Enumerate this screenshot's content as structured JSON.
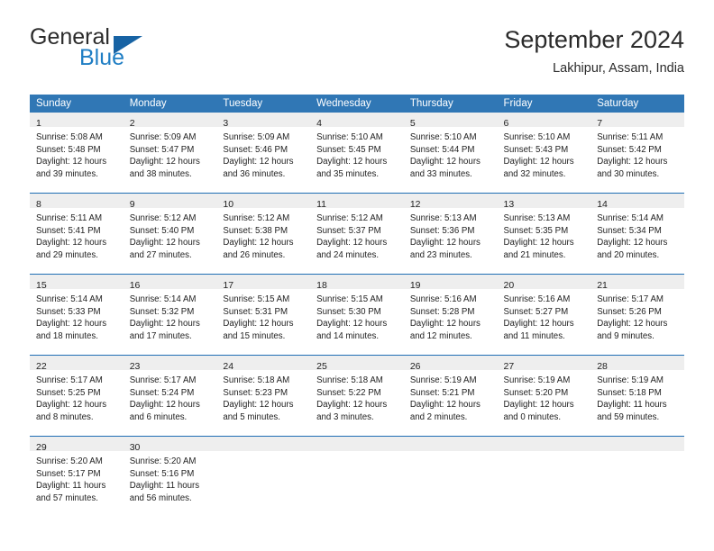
{
  "brand": {
    "word_one": "General",
    "word_two": "Blue",
    "triangle_icon": "triangle-icon",
    "accent_color": "#1763a4",
    "blue_text_color": "#1f7ec4"
  },
  "header": {
    "title": "September 2024",
    "subtitle": "Lakhipur, Assam, India"
  },
  "theme": {
    "header_band": "#3077b5",
    "week_separator": "#1f6eb4",
    "daynum_band": "#eeeeee"
  },
  "weekday_headers": [
    "Sunday",
    "Monday",
    "Tuesday",
    "Wednesday",
    "Thursday",
    "Friday",
    "Saturday"
  ],
  "weeks": [
    [
      {
        "day": "1",
        "sunrise": "Sunrise: 5:08 AM",
        "sunset": "Sunset: 5:48 PM",
        "daylight_line1": "Daylight: 12 hours",
        "daylight_line2": "and 39 minutes."
      },
      {
        "day": "2",
        "sunrise": "Sunrise: 5:09 AM",
        "sunset": "Sunset: 5:47 PM",
        "daylight_line1": "Daylight: 12 hours",
        "daylight_line2": "and 38 minutes."
      },
      {
        "day": "3",
        "sunrise": "Sunrise: 5:09 AM",
        "sunset": "Sunset: 5:46 PM",
        "daylight_line1": "Daylight: 12 hours",
        "daylight_line2": "and 36 minutes."
      },
      {
        "day": "4",
        "sunrise": "Sunrise: 5:10 AM",
        "sunset": "Sunset: 5:45 PM",
        "daylight_line1": "Daylight: 12 hours",
        "daylight_line2": "and 35 minutes."
      },
      {
        "day": "5",
        "sunrise": "Sunrise: 5:10 AM",
        "sunset": "Sunset: 5:44 PM",
        "daylight_line1": "Daylight: 12 hours",
        "daylight_line2": "and 33 minutes."
      },
      {
        "day": "6",
        "sunrise": "Sunrise: 5:10 AM",
        "sunset": "Sunset: 5:43 PM",
        "daylight_line1": "Daylight: 12 hours",
        "daylight_line2": "and 32 minutes."
      },
      {
        "day": "7",
        "sunrise": "Sunrise: 5:11 AM",
        "sunset": "Sunset: 5:42 PM",
        "daylight_line1": "Daylight: 12 hours",
        "daylight_line2": "and 30 minutes."
      }
    ],
    [
      {
        "day": "8",
        "sunrise": "Sunrise: 5:11 AM",
        "sunset": "Sunset: 5:41 PM",
        "daylight_line1": "Daylight: 12 hours",
        "daylight_line2": "and 29 minutes."
      },
      {
        "day": "9",
        "sunrise": "Sunrise: 5:12 AM",
        "sunset": "Sunset: 5:40 PM",
        "daylight_line1": "Daylight: 12 hours",
        "daylight_line2": "and 27 minutes."
      },
      {
        "day": "10",
        "sunrise": "Sunrise: 5:12 AM",
        "sunset": "Sunset: 5:38 PM",
        "daylight_line1": "Daylight: 12 hours",
        "daylight_line2": "and 26 minutes."
      },
      {
        "day": "11",
        "sunrise": "Sunrise: 5:12 AM",
        "sunset": "Sunset: 5:37 PM",
        "daylight_line1": "Daylight: 12 hours",
        "daylight_line2": "and 24 minutes."
      },
      {
        "day": "12",
        "sunrise": "Sunrise: 5:13 AM",
        "sunset": "Sunset: 5:36 PM",
        "daylight_line1": "Daylight: 12 hours",
        "daylight_line2": "and 23 minutes."
      },
      {
        "day": "13",
        "sunrise": "Sunrise: 5:13 AM",
        "sunset": "Sunset: 5:35 PM",
        "daylight_line1": "Daylight: 12 hours",
        "daylight_line2": "and 21 minutes."
      },
      {
        "day": "14",
        "sunrise": "Sunrise: 5:14 AM",
        "sunset": "Sunset: 5:34 PM",
        "daylight_line1": "Daylight: 12 hours",
        "daylight_line2": "and 20 minutes."
      }
    ],
    [
      {
        "day": "15",
        "sunrise": "Sunrise: 5:14 AM",
        "sunset": "Sunset: 5:33 PM",
        "daylight_line1": "Daylight: 12 hours",
        "daylight_line2": "and 18 minutes."
      },
      {
        "day": "16",
        "sunrise": "Sunrise: 5:14 AM",
        "sunset": "Sunset: 5:32 PM",
        "daylight_line1": "Daylight: 12 hours",
        "daylight_line2": "and 17 minutes."
      },
      {
        "day": "17",
        "sunrise": "Sunrise: 5:15 AM",
        "sunset": "Sunset: 5:31 PM",
        "daylight_line1": "Daylight: 12 hours",
        "daylight_line2": "and 15 minutes."
      },
      {
        "day": "18",
        "sunrise": "Sunrise: 5:15 AM",
        "sunset": "Sunset: 5:30 PM",
        "daylight_line1": "Daylight: 12 hours",
        "daylight_line2": "and 14 minutes."
      },
      {
        "day": "19",
        "sunrise": "Sunrise: 5:16 AM",
        "sunset": "Sunset: 5:28 PM",
        "daylight_line1": "Daylight: 12 hours",
        "daylight_line2": "and 12 minutes."
      },
      {
        "day": "20",
        "sunrise": "Sunrise: 5:16 AM",
        "sunset": "Sunset: 5:27 PM",
        "daylight_line1": "Daylight: 12 hours",
        "daylight_line2": "and 11 minutes."
      },
      {
        "day": "21",
        "sunrise": "Sunrise: 5:17 AM",
        "sunset": "Sunset: 5:26 PM",
        "daylight_line1": "Daylight: 12 hours",
        "daylight_line2": "and 9 minutes."
      }
    ],
    [
      {
        "day": "22",
        "sunrise": "Sunrise: 5:17 AM",
        "sunset": "Sunset: 5:25 PM",
        "daylight_line1": "Daylight: 12 hours",
        "daylight_line2": "and 8 minutes."
      },
      {
        "day": "23",
        "sunrise": "Sunrise: 5:17 AM",
        "sunset": "Sunset: 5:24 PM",
        "daylight_line1": "Daylight: 12 hours",
        "daylight_line2": "and 6 minutes."
      },
      {
        "day": "24",
        "sunrise": "Sunrise: 5:18 AM",
        "sunset": "Sunset: 5:23 PM",
        "daylight_line1": "Daylight: 12 hours",
        "daylight_line2": "and 5 minutes."
      },
      {
        "day": "25",
        "sunrise": "Sunrise: 5:18 AM",
        "sunset": "Sunset: 5:22 PM",
        "daylight_line1": "Daylight: 12 hours",
        "daylight_line2": "and 3 minutes."
      },
      {
        "day": "26",
        "sunrise": "Sunrise: 5:19 AM",
        "sunset": "Sunset: 5:21 PM",
        "daylight_line1": "Daylight: 12 hours",
        "daylight_line2": "and 2 minutes."
      },
      {
        "day": "27",
        "sunrise": "Sunrise: 5:19 AM",
        "sunset": "Sunset: 5:20 PM",
        "daylight_line1": "Daylight: 12 hours",
        "daylight_line2": "and 0 minutes."
      },
      {
        "day": "28",
        "sunrise": "Sunrise: 5:19 AM",
        "sunset": "Sunset: 5:18 PM",
        "daylight_line1": "Daylight: 11 hours",
        "daylight_line2": "and 59 minutes."
      }
    ],
    [
      {
        "day": "29",
        "sunrise": "Sunrise: 5:20 AM",
        "sunset": "Sunset: 5:17 PM",
        "daylight_line1": "Daylight: 11 hours",
        "daylight_line2": "and 57 minutes."
      },
      {
        "day": "30",
        "sunrise": "Sunrise: 5:20 AM",
        "sunset": "Sunset: 5:16 PM",
        "daylight_line1": "Daylight: 11 hours",
        "daylight_line2": "and 56 minutes."
      },
      {
        "day": "",
        "sunrise": "",
        "sunset": "",
        "daylight_line1": "",
        "daylight_line2": ""
      },
      {
        "day": "",
        "sunrise": "",
        "sunset": "",
        "daylight_line1": "",
        "daylight_line2": ""
      },
      {
        "day": "",
        "sunrise": "",
        "sunset": "",
        "daylight_line1": "",
        "daylight_line2": ""
      },
      {
        "day": "",
        "sunrise": "",
        "sunset": "",
        "daylight_line1": "",
        "daylight_line2": ""
      },
      {
        "day": "",
        "sunrise": "",
        "sunset": "",
        "daylight_line1": "",
        "daylight_line2": ""
      }
    ]
  ]
}
